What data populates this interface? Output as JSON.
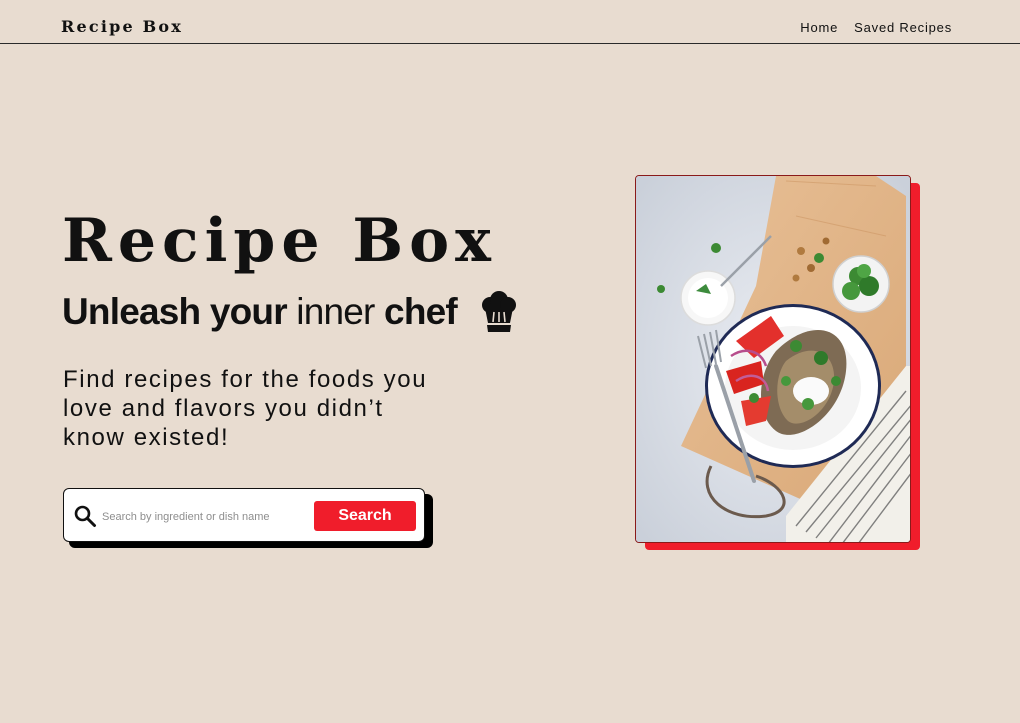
{
  "header": {
    "brand": "Recipe Box",
    "nav": [
      {
        "label": "Home"
      },
      {
        "label": "Saved Recipes"
      }
    ]
  },
  "hero": {
    "title": "Recipe Box",
    "tagline": {
      "part1": "Unleash your",
      "part2": "inner",
      "part3": "chef"
    },
    "tagline_icon": "chef-hat-icon",
    "description": "Find recipes for the foods you love and flavors you didn’t know existed!"
  },
  "search": {
    "icon": "search-icon",
    "placeholder": "Search by ingredient or dish name",
    "value": "",
    "button_label": "Search"
  },
  "feature_image": {
    "subject": "plated dish on a wooden board",
    "accent_color": "#f01d2b"
  },
  "colors": {
    "background": "#e8dcd0",
    "accent": "#f01d2b",
    "text": "#111111"
  }
}
